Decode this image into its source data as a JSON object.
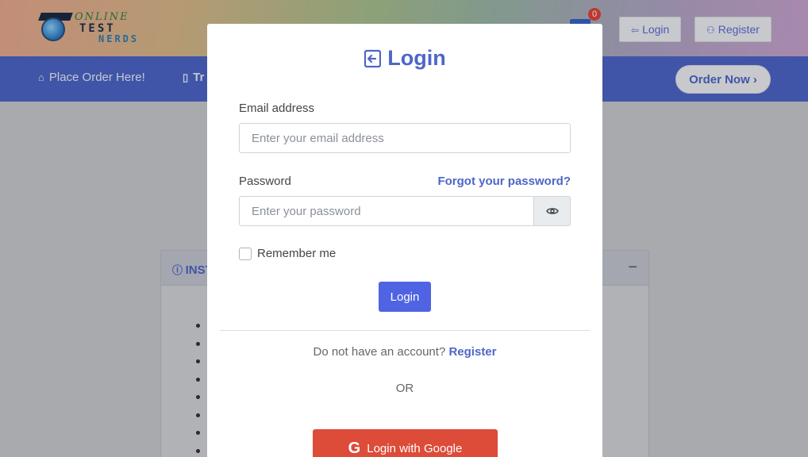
{
  "site": {
    "logo": {
      "line1": "ONLINE",
      "line2": "TEST",
      "line3": "NERDS"
    },
    "cart_count": "0",
    "header_buttons": {
      "login": "Login",
      "register": "Register"
    },
    "nav": {
      "place_order": "Place Order Here!",
      "partial": "Tr"
    },
    "order_now": "Order Now",
    "panel_title_partial": "INST"
  },
  "modal": {
    "title": "Login",
    "email": {
      "label": "Email address",
      "placeholder": "Enter your email address",
      "value": ""
    },
    "password": {
      "label": "Password",
      "placeholder": "Enter your password",
      "value": "",
      "forgot": "Forgot your password?"
    },
    "remember_label": "Remember me",
    "submit_label": "Login",
    "signup": {
      "prompt": "Do not have an account?",
      "link": "Register"
    },
    "or": "OR",
    "google_label": "Login with Google"
  },
  "colors": {
    "primary": "#4d66c9",
    "button": "#4f63e3",
    "google": "#dd4b39",
    "badge": "#e0433b"
  },
  "icons": [
    "home-icon",
    "document-icon",
    "login-icon",
    "user-plus-icon",
    "cart-icon",
    "chevron-right-icon",
    "info-icon",
    "minus-icon",
    "eye-icon",
    "google-icon"
  ]
}
